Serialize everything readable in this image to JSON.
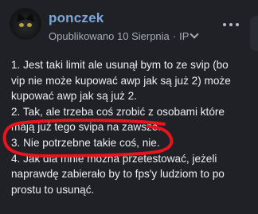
{
  "post": {
    "author": "ponczek",
    "published": "Opublikowano 10 Sierpnia",
    "separator": "·",
    "visibility": "IP",
    "lines": [
      "1. Jest taki limit ale usunął bym to ze svip (bo",
      "vip nie może kupować awp jak są już 2) może",
      "kupować awp jak są już 2.",
      "2. Tak, ale trzeba coś zrobić z osobami które",
      "mają już tego svipa na zawsze.",
      "3. Nie potrzebne takie coś, nie.",
      "4. Jak dla mnie można przetestować, jeżeli",
      "naprawdę zabierało by to fps'y ludziom to po",
      "prostu to usunąć."
    ]
  },
  "icons": {
    "avatar": "black-cat-avatar",
    "more": "more-options-icon",
    "chevron": "chevron-down-icon"
  },
  "colors": {
    "background": "#1f2127",
    "author": "#7fa6d9",
    "meta": "#a9acb4",
    "text": "#eceef2",
    "annotation": "#e8141c"
  }
}
